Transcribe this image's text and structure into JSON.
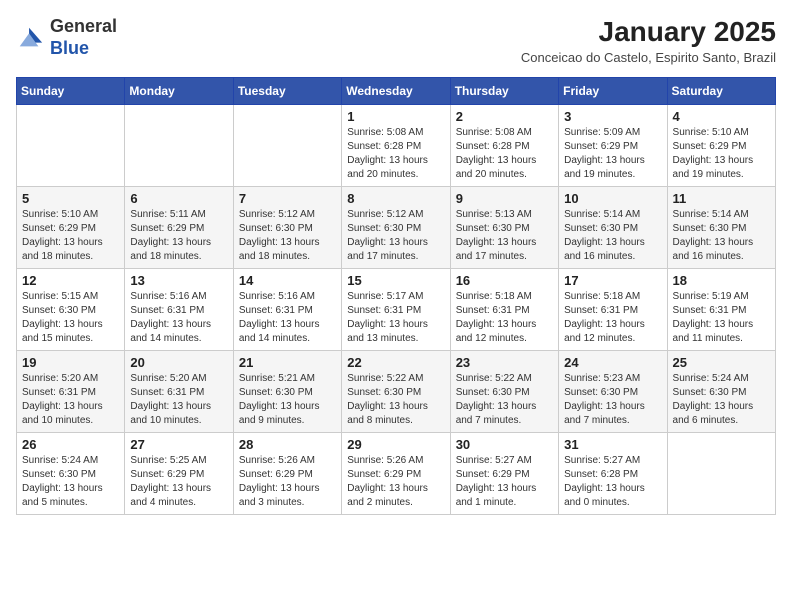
{
  "header": {
    "logo_line1": "General",
    "logo_line2": "Blue",
    "title": "January 2025",
    "subtitle": "Conceicao do Castelo, Espirito Santo, Brazil"
  },
  "weekdays": [
    "Sunday",
    "Monday",
    "Tuesday",
    "Wednesday",
    "Thursday",
    "Friday",
    "Saturday"
  ],
  "weeks": [
    [
      {
        "day": "",
        "info": ""
      },
      {
        "day": "",
        "info": ""
      },
      {
        "day": "",
        "info": ""
      },
      {
        "day": "1",
        "info": "Sunrise: 5:08 AM\nSunset: 6:28 PM\nDaylight: 13 hours\nand 20 minutes."
      },
      {
        "day": "2",
        "info": "Sunrise: 5:08 AM\nSunset: 6:28 PM\nDaylight: 13 hours\nand 20 minutes."
      },
      {
        "day": "3",
        "info": "Sunrise: 5:09 AM\nSunset: 6:29 PM\nDaylight: 13 hours\nand 19 minutes."
      },
      {
        "day": "4",
        "info": "Sunrise: 5:10 AM\nSunset: 6:29 PM\nDaylight: 13 hours\nand 19 minutes."
      }
    ],
    [
      {
        "day": "5",
        "info": "Sunrise: 5:10 AM\nSunset: 6:29 PM\nDaylight: 13 hours\nand 18 minutes."
      },
      {
        "day": "6",
        "info": "Sunrise: 5:11 AM\nSunset: 6:29 PM\nDaylight: 13 hours\nand 18 minutes."
      },
      {
        "day": "7",
        "info": "Sunrise: 5:12 AM\nSunset: 6:30 PM\nDaylight: 13 hours\nand 18 minutes."
      },
      {
        "day": "8",
        "info": "Sunrise: 5:12 AM\nSunset: 6:30 PM\nDaylight: 13 hours\nand 17 minutes."
      },
      {
        "day": "9",
        "info": "Sunrise: 5:13 AM\nSunset: 6:30 PM\nDaylight: 13 hours\nand 17 minutes."
      },
      {
        "day": "10",
        "info": "Sunrise: 5:14 AM\nSunset: 6:30 PM\nDaylight: 13 hours\nand 16 minutes."
      },
      {
        "day": "11",
        "info": "Sunrise: 5:14 AM\nSunset: 6:30 PM\nDaylight: 13 hours\nand 16 minutes."
      }
    ],
    [
      {
        "day": "12",
        "info": "Sunrise: 5:15 AM\nSunset: 6:30 PM\nDaylight: 13 hours\nand 15 minutes."
      },
      {
        "day": "13",
        "info": "Sunrise: 5:16 AM\nSunset: 6:31 PM\nDaylight: 13 hours\nand 14 minutes."
      },
      {
        "day": "14",
        "info": "Sunrise: 5:16 AM\nSunset: 6:31 PM\nDaylight: 13 hours\nand 14 minutes."
      },
      {
        "day": "15",
        "info": "Sunrise: 5:17 AM\nSunset: 6:31 PM\nDaylight: 13 hours\nand 13 minutes."
      },
      {
        "day": "16",
        "info": "Sunrise: 5:18 AM\nSunset: 6:31 PM\nDaylight: 13 hours\nand 12 minutes."
      },
      {
        "day": "17",
        "info": "Sunrise: 5:18 AM\nSunset: 6:31 PM\nDaylight: 13 hours\nand 12 minutes."
      },
      {
        "day": "18",
        "info": "Sunrise: 5:19 AM\nSunset: 6:31 PM\nDaylight: 13 hours\nand 11 minutes."
      }
    ],
    [
      {
        "day": "19",
        "info": "Sunrise: 5:20 AM\nSunset: 6:31 PM\nDaylight: 13 hours\nand 10 minutes."
      },
      {
        "day": "20",
        "info": "Sunrise: 5:20 AM\nSunset: 6:31 PM\nDaylight: 13 hours\nand 10 minutes."
      },
      {
        "day": "21",
        "info": "Sunrise: 5:21 AM\nSunset: 6:30 PM\nDaylight: 13 hours\nand 9 minutes."
      },
      {
        "day": "22",
        "info": "Sunrise: 5:22 AM\nSunset: 6:30 PM\nDaylight: 13 hours\nand 8 minutes."
      },
      {
        "day": "23",
        "info": "Sunrise: 5:22 AM\nSunset: 6:30 PM\nDaylight: 13 hours\nand 7 minutes."
      },
      {
        "day": "24",
        "info": "Sunrise: 5:23 AM\nSunset: 6:30 PM\nDaylight: 13 hours\nand 7 minutes."
      },
      {
        "day": "25",
        "info": "Sunrise: 5:24 AM\nSunset: 6:30 PM\nDaylight: 13 hours\nand 6 minutes."
      }
    ],
    [
      {
        "day": "26",
        "info": "Sunrise: 5:24 AM\nSunset: 6:30 PM\nDaylight: 13 hours\nand 5 minutes."
      },
      {
        "day": "27",
        "info": "Sunrise: 5:25 AM\nSunset: 6:29 PM\nDaylight: 13 hours\nand 4 minutes."
      },
      {
        "day": "28",
        "info": "Sunrise: 5:26 AM\nSunset: 6:29 PM\nDaylight: 13 hours\nand 3 minutes."
      },
      {
        "day": "29",
        "info": "Sunrise: 5:26 AM\nSunset: 6:29 PM\nDaylight: 13 hours\nand 2 minutes."
      },
      {
        "day": "30",
        "info": "Sunrise: 5:27 AM\nSunset: 6:29 PM\nDaylight: 13 hours\nand 1 minute."
      },
      {
        "day": "31",
        "info": "Sunrise: 5:27 AM\nSunset: 6:28 PM\nDaylight: 13 hours\nand 0 minutes."
      },
      {
        "day": "",
        "info": ""
      }
    ]
  ]
}
